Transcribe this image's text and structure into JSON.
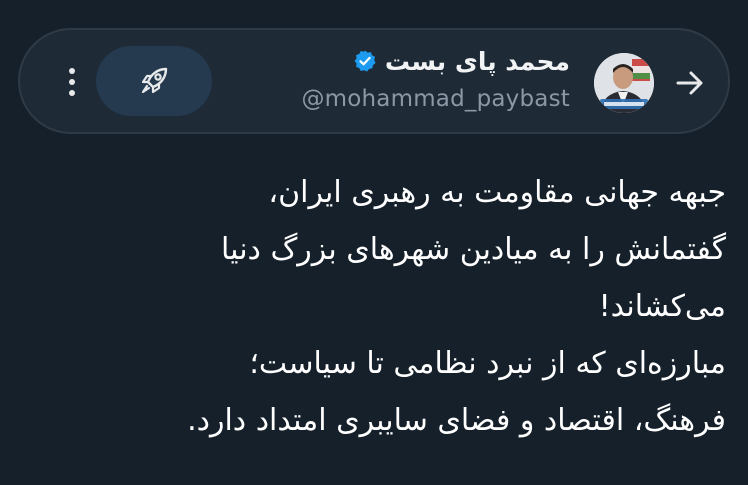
{
  "header": {
    "display_name": "محمد پای بست",
    "handle": "@mohammad_paybast",
    "verified": true,
    "back_icon": "arrow-right-icon",
    "action_icon": "rocket-icon",
    "more_icon": "more-vertical-icon",
    "colors": {
      "background": "#15202b",
      "pill": "#1e2a36",
      "rocket_button": "#253a4f",
      "verified": "#1d9bf0",
      "handle": "#8b98a5"
    }
  },
  "tweet": {
    "lines": [
      "جبهه جهانی مقاومت به رهبری ایران،",
      "گفتمانش را به میادین شهرهای بزرگ دنیا",
      "می‌کشاند!",
      "مبارزه‌ای که از نبرد نظامی تا سیاست؛",
      "فرهنگ، اقتصاد و فضای سایبری امتداد دارد."
    ]
  }
}
